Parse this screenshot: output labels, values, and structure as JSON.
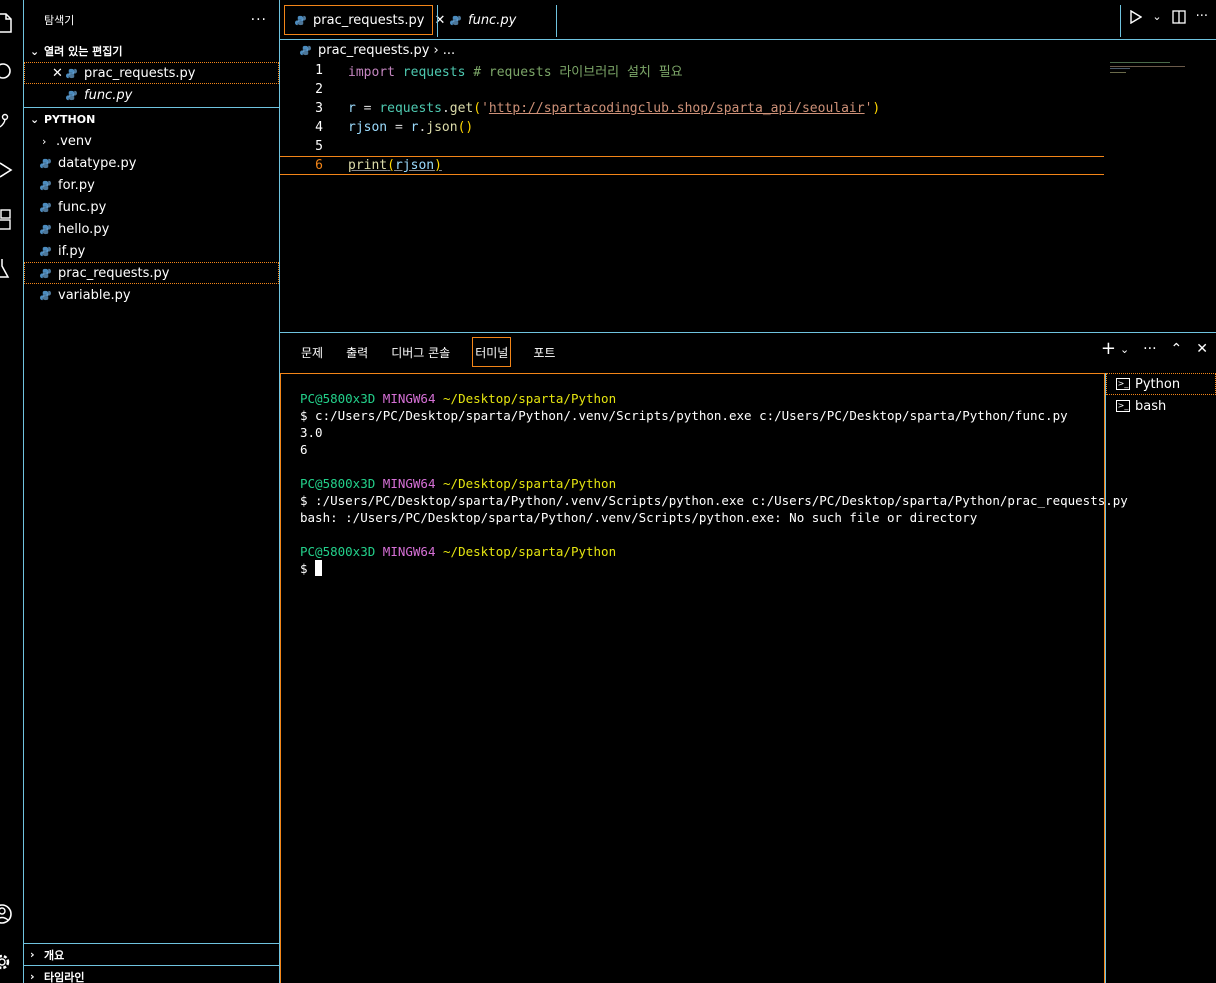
{
  "sidebar": {
    "title": "탐색기",
    "more": "···",
    "open_editors": {
      "title": "열려 있는 편집기",
      "items": [
        {
          "name": "prac_requests.py",
          "close": "✕"
        },
        {
          "name": "func.py"
        }
      ]
    },
    "folder": {
      "title": "PYTHON",
      "items": [
        ".venv",
        "datatype.py",
        "for.py",
        "func.py",
        "hello.py",
        "if.py",
        "prac_requests.py",
        "variable.py"
      ]
    },
    "outline": "개요",
    "timeline": "타임라인"
  },
  "tabs": [
    {
      "label": "prac_requests.py",
      "close": "✕"
    },
    {
      "label": "func.py"
    }
  ],
  "breadcrumb": {
    "file": "prac_requests.py",
    "sep": "›",
    "rest": "..."
  },
  "editor": {
    "line_numbers": [
      "1",
      "2",
      "3",
      "4",
      "5",
      "6"
    ],
    "line1": {
      "kw": "import",
      "mod": "requests",
      "comment": "# requests 라이브러리 설치 필요"
    },
    "line3": {
      "var": "r",
      "eq": " = ",
      "mod": "requests",
      "dot": ".",
      "fn": "get",
      "open": "(",
      "q1": "'",
      "url": "http://spartacodingclub.shop/sparta_api/seoulair",
      "q2": "'",
      "close": ")"
    },
    "line4": {
      "var": "rjson",
      "eq": " = ",
      "obj": "r",
      "dot": ".",
      "fn": "json",
      "parens": "()"
    },
    "line6": {
      "fn": "print",
      "open": "(",
      "arg": "rjson",
      "close": ")"
    }
  },
  "panel": {
    "tabs": [
      "문제",
      "출력",
      "디버그 콘솔",
      "터미널",
      "포트"
    ],
    "active_tab": "터미널",
    "actions": {
      "add": "+",
      "dropdown": "⌄",
      "more": "···",
      "maximize": "⌃",
      "close": "✕"
    },
    "terminal": {
      "user": "PC@5800x3D",
      "shell": "MINGW64",
      "path": "~/Desktop/sparta/Python",
      "cmd1": "$ c:/Users/PC/Desktop/sparta/Python/.venv/Scripts/python.exe c:/Users/PC/Desktop/sparta/Python/func.py",
      "out1": "3.0",
      "out2": "6",
      "cmd2": "$ :/Users/PC/Desktop/sparta/Python/.venv/Scripts/python.exe c:/Users/PC/Desktop/sparta/Python/prac_requests.py",
      "err": "bash: :/Users/PC/Desktop/sparta/Python/.venv/Scripts/python.exe: No such file or directory",
      "prompt": "$ "
    },
    "terminal_list": [
      "Python",
      "bash"
    ]
  },
  "colors": {
    "accent_orange": "#f38518",
    "border_blue": "#6fc3df",
    "prompt_green": "#23d18b",
    "prompt_magenta": "#d670d6",
    "prompt_yellow": "#e5e510"
  },
  "icons": [
    "explorer-icon",
    "search-icon",
    "source-control-icon",
    "run-debug-icon",
    "extensions-icon",
    "testing-icon",
    "account-icon",
    "settings-gear-icon",
    "python-file-icon",
    "run-icon",
    "split-editor-icon",
    "terminal-icon"
  ]
}
